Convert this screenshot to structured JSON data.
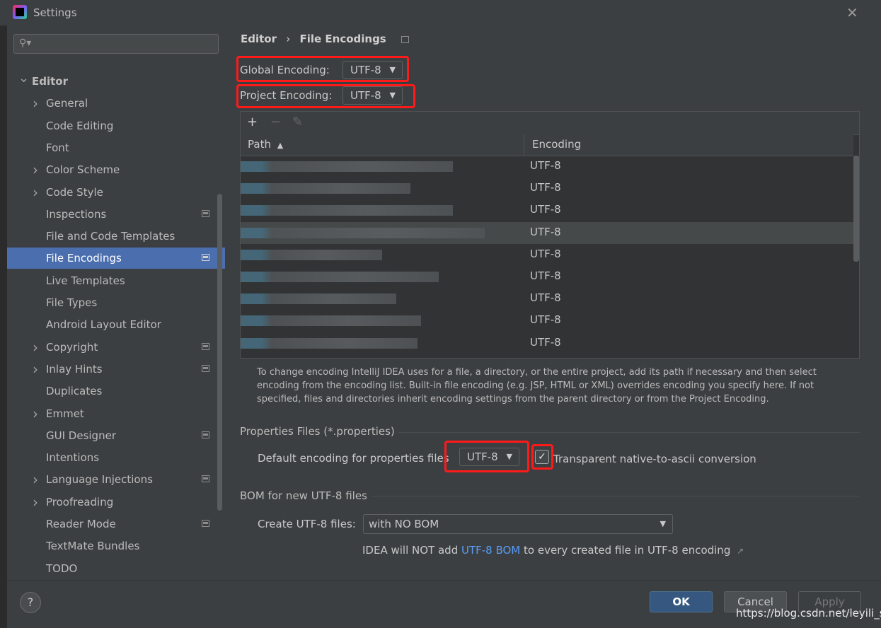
{
  "window": {
    "title": "Settings"
  },
  "search": {
    "placeholder": ""
  },
  "sidebar": {
    "items": [
      {
        "label": "Editor",
        "indent": 0,
        "chevron": "down",
        "pinned": false,
        "selected": false
      },
      {
        "label": "General",
        "indent": 1,
        "chevron": "right",
        "pinned": false,
        "selected": false
      },
      {
        "label": "Code Editing",
        "indent": 1,
        "chevron": "",
        "pinned": false,
        "selected": false
      },
      {
        "label": "Font",
        "indent": 1,
        "chevron": "",
        "pinned": false,
        "selected": false
      },
      {
        "label": "Color Scheme",
        "indent": 1,
        "chevron": "right",
        "pinned": false,
        "selected": false
      },
      {
        "label": "Code Style",
        "indent": 1,
        "chevron": "right",
        "pinned": false,
        "selected": false
      },
      {
        "label": "Inspections",
        "indent": 1,
        "chevron": "",
        "pinned": true,
        "selected": false
      },
      {
        "label": "File and Code Templates",
        "indent": 1,
        "chevron": "",
        "pinned": false,
        "selected": false
      },
      {
        "label": "File Encodings",
        "indent": 1,
        "chevron": "",
        "pinned": true,
        "selected": true
      },
      {
        "label": "Live Templates",
        "indent": 1,
        "chevron": "",
        "pinned": false,
        "selected": false
      },
      {
        "label": "File Types",
        "indent": 1,
        "chevron": "",
        "pinned": false,
        "selected": false
      },
      {
        "label": "Android Layout Editor",
        "indent": 1,
        "chevron": "",
        "pinned": false,
        "selected": false
      },
      {
        "label": "Copyright",
        "indent": 1,
        "chevron": "right",
        "pinned": true,
        "selected": false
      },
      {
        "label": "Inlay Hints",
        "indent": 1,
        "chevron": "right",
        "pinned": true,
        "selected": false
      },
      {
        "label": "Duplicates",
        "indent": 1,
        "chevron": "",
        "pinned": false,
        "selected": false
      },
      {
        "label": "Emmet",
        "indent": 1,
        "chevron": "right",
        "pinned": false,
        "selected": false
      },
      {
        "label": "GUI Designer",
        "indent": 1,
        "chevron": "",
        "pinned": true,
        "selected": false
      },
      {
        "label": "Intentions",
        "indent": 1,
        "chevron": "",
        "pinned": false,
        "selected": false
      },
      {
        "label": "Language Injections",
        "indent": 1,
        "chevron": "right",
        "pinned": true,
        "selected": false
      },
      {
        "label": "Proofreading",
        "indent": 1,
        "chevron": "right",
        "pinned": false,
        "selected": false
      },
      {
        "label": "Reader Mode",
        "indent": 1,
        "chevron": "",
        "pinned": true,
        "selected": false
      },
      {
        "label": "TextMate Bundles",
        "indent": 1,
        "chevron": "",
        "pinned": false,
        "selected": false
      },
      {
        "label": "TODO",
        "indent": 1,
        "chevron": "",
        "pinned": false,
        "selected": false
      }
    ]
  },
  "breadcrumb": {
    "parent": "Editor",
    "separator": "›",
    "current": "File Encodings"
  },
  "encodings": {
    "global_label": "Global Encoding:",
    "global_value": "UTF-8",
    "project_label": "Project Encoding:",
    "project_value": "UTF-8"
  },
  "table": {
    "col_path": "Path",
    "col_encoding": "Encoding",
    "sort_indicator": "▲",
    "rows": [
      "UTF-8",
      "UTF-8",
      "UTF-8",
      "UTF-8",
      "UTF-8",
      "UTF-8",
      "UTF-8",
      "UTF-8",
      "UTF-8"
    ],
    "selected_row": 3
  },
  "help_text": "To change encoding IntelliJ IDEA uses for a file, a directory, or the entire project, add its path if necessary and then select encoding from the encoding list. Built-in file encoding (e.g. JSP, HTML or XML) overrides encoding you specify here. If not specified, files and directories inherit encoding settings from the parent directory or from the Project Encoding.",
  "properties": {
    "section_title": "Properties Files (*.properties)",
    "default_label": "Default encoding for properties files",
    "default_value": "UTF-8",
    "native_checkbox_label": "Transparent native-to-ascii conversion",
    "native_checked": true
  },
  "bom": {
    "section_title": "BOM for new UTF-8 files",
    "create_label": "Create UTF-8 files:",
    "create_value": "with NO BOM",
    "note_prefix": "IDEA will NOT add ",
    "note_link": "UTF-8 BOM",
    "note_suffix": " to every created file in UTF-8 encoding",
    "note_arrow": "↗"
  },
  "footer": {
    "help": "?",
    "ok": "OK",
    "cancel": "Cancel",
    "apply": "Apply"
  },
  "watermark": "https://blog.csdn.net/leyili_s",
  "colors": {
    "accent": "#4b6eaf",
    "highlight": "#ff1a1a",
    "link": "#589df6",
    "ok_button": "#365880"
  }
}
